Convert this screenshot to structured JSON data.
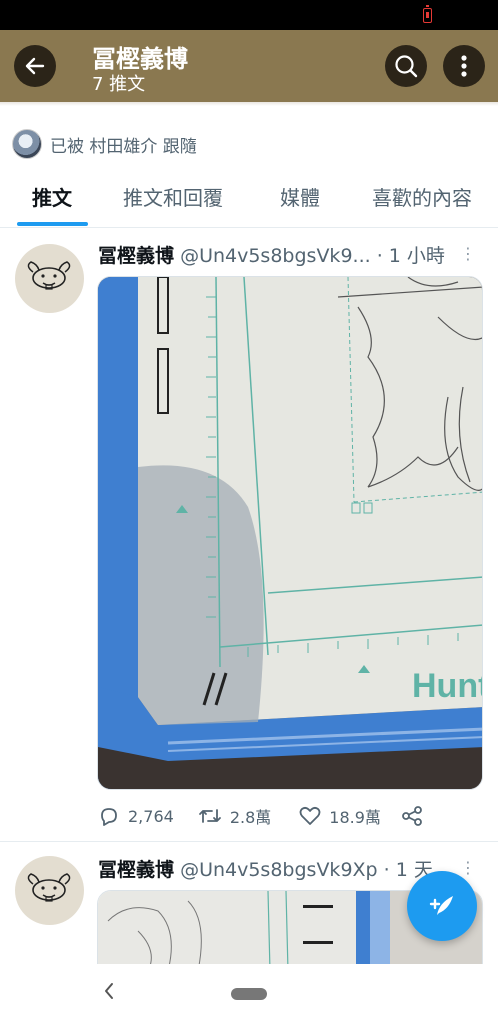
{
  "appbar": {
    "title": "冨樫義博",
    "subtitle": "7 推文",
    "back_icon": "arrow-left-icon",
    "search_icon": "search-icon",
    "more_icon": "more-vertical-icon",
    "color": "#8a7850"
  },
  "followed_by": {
    "text": "已被 村田雄介 跟隨"
  },
  "tabs": [
    {
      "label": "推文",
      "active": true
    },
    {
      "label": "推文和回覆",
      "active": false
    },
    {
      "label": "媒體",
      "active": false
    },
    {
      "label": "喜歡的內容",
      "active": false
    }
  ],
  "tweets": [
    {
      "name": "冨樫義博",
      "handle": "@Un4v5s8bgsVk9...",
      "separator": "·",
      "time": "1 小時",
      "ruler_brand": "Hunt",
      "actions": {
        "replies": "2,764",
        "retweets": "2.8萬",
        "likes": "18.9萬"
      }
    },
    {
      "name": "冨樫義博",
      "handle": "@Un4v5s8bgsVk9Xp",
      "separator": "·",
      "time": "1 天"
    }
  ],
  "colors": {
    "accent": "#1d9bf0",
    "muted": "#536471",
    "frame_blue": "#3f7fd0"
  }
}
